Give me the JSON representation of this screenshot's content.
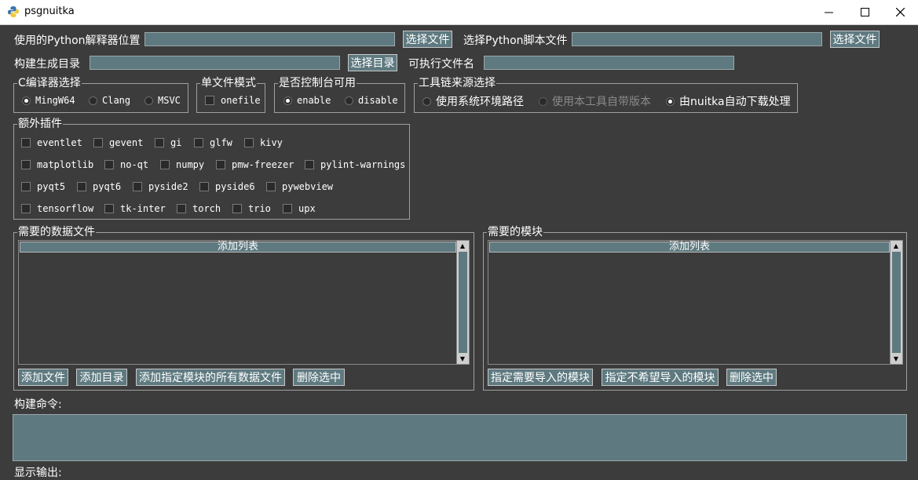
{
  "window": {
    "title": "psgnuitka"
  },
  "row1": {
    "interpreter_label": "使用的Python解释器位置",
    "interpreter_value": "",
    "interpreter_button": "选择文件",
    "script_label": "选择Python脚本文件",
    "script_value": "",
    "script_button": "选择文件"
  },
  "row2": {
    "output_dir_label": "构建生成目录",
    "output_dir_value": "",
    "output_dir_button": "选择目录",
    "exe_name_label": "可执行文件名",
    "exe_name_value": ""
  },
  "compiler": {
    "legend": "C编译器选择",
    "options": [
      {
        "label": "MingW64",
        "selected": true
      },
      {
        "label": "Clang",
        "selected": false
      },
      {
        "label": "MSVC",
        "selected": false
      }
    ]
  },
  "single_file": {
    "legend": "单文件模式",
    "option": "onefile",
    "checked": false
  },
  "console": {
    "legend": "是否控制台可用",
    "options": [
      {
        "label": "enable",
        "selected": true
      },
      {
        "label": "disable",
        "selected": false
      }
    ]
  },
  "toolchain": {
    "legend": "工具链来源选择",
    "options": [
      {
        "label": "使用系统环境路径",
        "selected": false,
        "disabled": false
      },
      {
        "label": "使用本工具自带版本",
        "selected": false,
        "disabled": true
      },
      {
        "label": "由nuitka自动下载处理",
        "selected": true,
        "disabled": false
      }
    ]
  },
  "plugins": {
    "legend": "额外插件",
    "rows": [
      [
        "eventlet",
        "gevent",
        "gi",
        "glfw",
        "kivy"
      ],
      [
        "matplotlib",
        "no-qt",
        "numpy",
        "pmw-freezer",
        "pylint-warnings"
      ],
      [
        "pyqt5",
        "pyqt6",
        "pyside2",
        "pyside6",
        "pywebview"
      ],
      [
        "tensorflow",
        "tk-inter",
        "torch",
        "trio",
        "upx"
      ]
    ]
  },
  "data_files": {
    "legend": "需要的数据文件",
    "list_header": "添加列表",
    "buttons": [
      "添加文件",
      "添加目录",
      "添加指定模块的所有数据文件",
      "删除选中"
    ]
  },
  "modules": {
    "legend": "需要的模块",
    "list_header": "添加列表",
    "buttons": [
      "指定需要导入的模块",
      "指定不希望导入的模块",
      "删除选中"
    ]
  },
  "build_command": {
    "label": "构建命令:",
    "value": ""
  },
  "output": {
    "label": "显示输出:"
  }
}
